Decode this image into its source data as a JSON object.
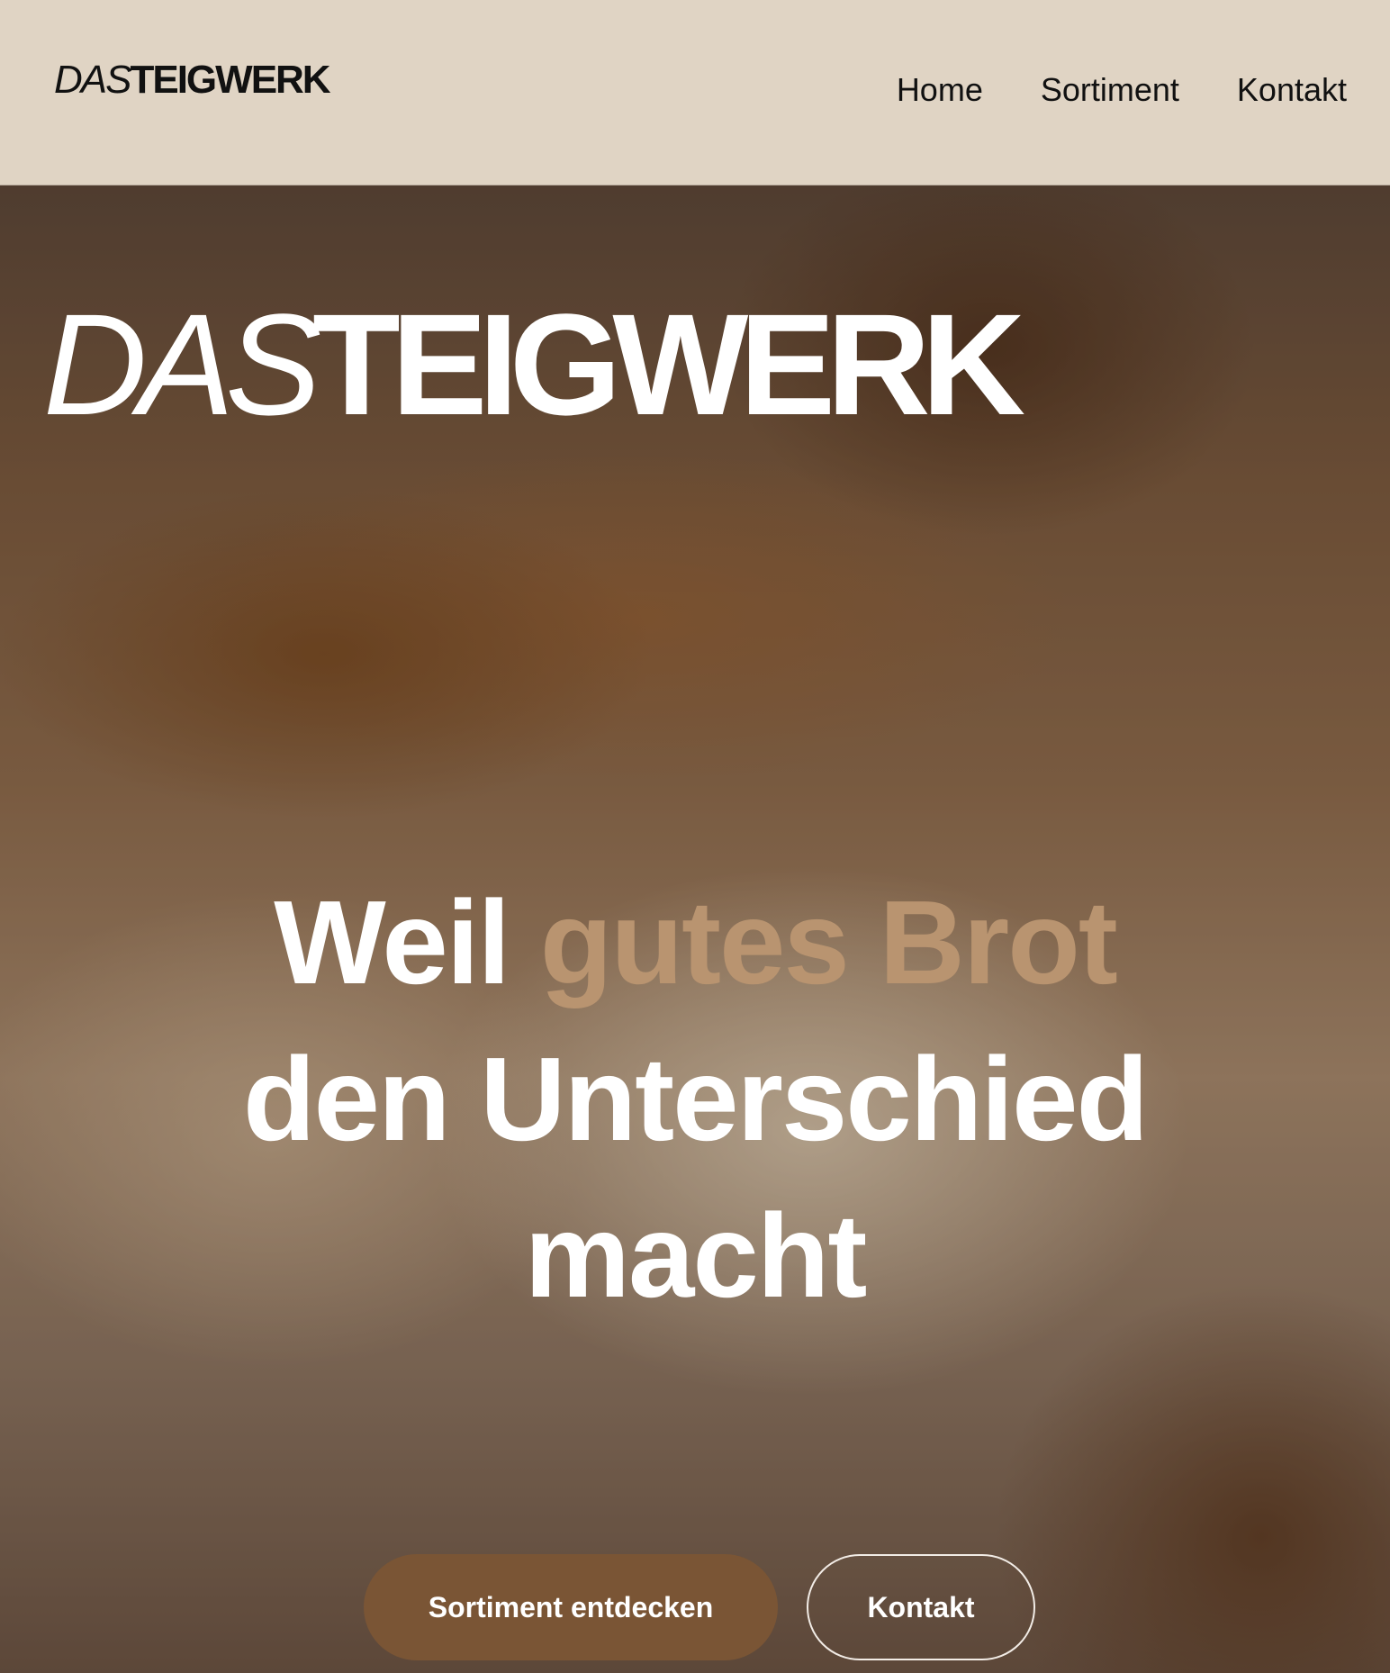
{
  "header": {
    "logo": {
      "light": "DAS",
      "bold": "TEIGWERK"
    },
    "nav": [
      "Home",
      "Sortiment",
      "Kontakt"
    ],
    "background_color": "#e0d4c4"
  },
  "hero": {
    "logo": {
      "light": "DAS",
      "bold": "TEIGWERK"
    },
    "headline": {
      "line1_start": "Weil ",
      "line1_accent": "gutes Brot",
      "line2": "den Unterschied",
      "line3": "macht"
    },
    "accent_color": "#b99470",
    "buttons": {
      "primary": "Sortiment entdecken",
      "secondary": "Kontakt"
    },
    "primary_button_color": "#7a5535"
  }
}
